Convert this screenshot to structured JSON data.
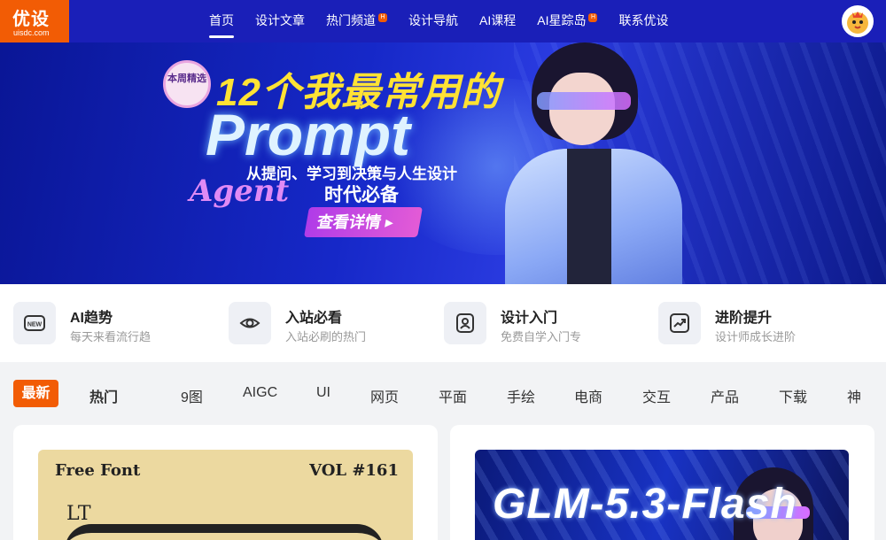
{
  "header": {
    "logo_main": "优设",
    "logo_sub": "uisdc.com",
    "nav": [
      {
        "label": "首页",
        "active": true,
        "hot": false
      },
      {
        "label": "设计文章",
        "active": false,
        "hot": false
      },
      {
        "label": "热门频道",
        "active": false,
        "hot": true
      },
      {
        "label": "设计导航",
        "active": false,
        "hot": false
      },
      {
        "label": "AI课程",
        "active": false,
        "hot": false
      },
      {
        "label": "AI星踪岛",
        "active": false,
        "hot": true
      },
      {
        "label": "联系优设",
        "active": false,
        "hot": false
      }
    ],
    "hot_badge": "H"
  },
  "banner": {
    "badge": "本周精选",
    "title_line1": "12个我最常用的",
    "title_line2": "Prompt",
    "subtitle": "从提问、学习到决策与人生设计",
    "agent": "Agent",
    "era": "时代必备",
    "cta": "查看详情"
  },
  "categories": [
    {
      "title": "AI趋势",
      "desc": "每天来看流行趋",
      "icon": "new-icon"
    },
    {
      "title": "入站必看",
      "desc": "入站必刷的热门",
      "icon": "eye-icon"
    },
    {
      "title": "设计入门",
      "desc": "免费自学入门专",
      "icon": "user-card-icon"
    },
    {
      "title": "进阶提升",
      "desc": "设计师成长进阶",
      "icon": "trend-chart-icon"
    }
  ],
  "tabs": {
    "active": "最新",
    "items": [
      "热门",
      "9图",
      "AIGC",
      "UI",
      "网页",
      "平面",
      "手绘",
      "电商",
      "交互",
      "产品",
      "下载",
      "神"
    ]
  },
  "cards": [
    {
      "ff": "Free Font",
      "vol": "VOL #161",
      "lt": "LT"
    },
    {
      "headline": "GLM-5.3-Flash"
    }
  ],
  "colors": {
    "brand_orange": "#f25c05",
    "header_blue": "#1a1fb8"
  }
}
